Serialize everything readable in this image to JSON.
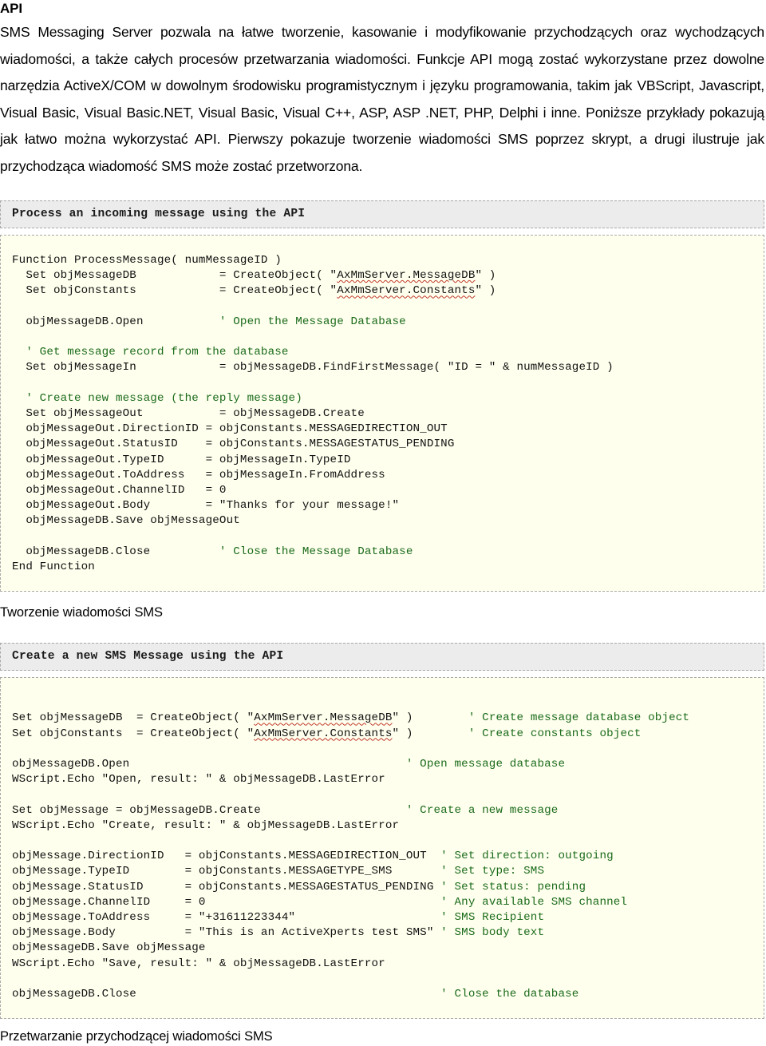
{
  "document": {
    "title": "API",
    "intro_paragraph": "SMS Messaging Server pozwala na łatwe tworzenie, kasowanie i modyfikowanie przychodzących oraz wychodzących wiadomości, a także całych procesów przetwarzania wiadomości. Funkcje API mogą zostać wykorzystane przez dowolne narzędzia ActiveX/COM w dowolnym środowisku programistycznym i języku programowania, takim jak VBScript, Javascript, Visual Basic, Visual Basic.NET, Visual Basic, Visual C++, ASP, ASP .NET, PHP, Delphi i inne. Poniższe przykłady pokazują jak łatwo można wykorzystać API. Pierwszy pokazuje tworzenie wiadomości SMS poprzez skrypt, a drugi ilustruje jak przychodząca wiadomość SMS może zostać przetworzona."
  },
  "sample_one": {
    "header": "Process an incoming message using the API",
    "caption": "Tworzenie wiadomości SMS",
    "lines": [
      {
        "text": "Function ProcessMessage( numMessageID )"
      },
      {
        "pre": "  Set objMessageDB            = CreateObject( \"",
        "warn": "AxMmServer.MessageDB",
        "post": "\" )"
      },
      {
        "pre": "  Set objConstants            = CreateObject( \"",
        "warn": "AxMmServer.Constants",
        "post": "\" )"
      },
      {
        "text": ""
      },
      {
        "pre": "  objMessageDB.Open           ",
        "comment": "' Open the Message Database"
      },
      {
        "text": ""
      },
      {
        "pre": "  ",
        "comment": "' Get message record from the database"
      },
      {
        "text": "  Set objMessageIn            = objMessageDB.FindFirstMessage( \"ID = \" & numMessageID )"
      },
      {
        "text": ""
      },
      {
        "pre": "  ",
        "comment": "' Create new message (the reply message)"
      },
      {
        "text": "  Set objMessageOut           = objMessageDB.Create"
      },
      {
        "text": "  objMessageOut.DirectionID = objConstants.MESSAGEDIRECTION_OUT"
      },
      {
        "text": "  objMessageOut.StatusID    = objConstants.MESSAGESTATUS_PENDING"
      },
      {
        "text": "  objMessageOut.TypeID      = objMessageIn.TypeID"
      },
      {
        "text": "  objMessageOut.ToAddress   = objMessageIn.FromAddress"
      },
      {
        "text": "  objMessageOut.ChannelID   = 0"
      },
      {
        "text": "  objMessageOut.Body        = \"Thanks for your message!\""
      },
      {
        "text": "  objMessageDB.Save objMessageOut"
      },
      {
        "text": ""
      },
      {
        "pre": "  objMessageDB.Close          ",
        "comment": "' Close the Message Database"
      },
      {
        "text": "End Function"
      }
    ]
  },
  "sample_two": {
    "header": "Create a new SMS Message using the API",
    "caption": "Przetwarzanie przychodzącej wiadomości SMS",
    "lines": [
      {
        "text": ""
      },
      {
        "pre": "Set objMessageDB  = CreateObject( \"",
        "warn": "AxMmServer.MessageDB",
        "post": "\" )        ",
        "comment": "' Create message database object"
      },
      {
        "pre": "Set objConstants  = CreateObject( \"",
        "warn": "AxMmServer.Constants",
        "post": "\" )        ",
        "comment": "' Create constants object"
      },
      {
        "text": ""
      },
      {
        "pre": "objMessageDB.Open                                        ",
        "comment": "' Open message database"
      },
      {
        "text": "WScript.Echo \"Open, result: \" & objMessageDB.LastError"
      },
      {
        "text": ""
      },
      {
        "pre": "Set objMessage = objMessageDB.Create                     ",
        "comment": "' Create a new message"
      },
      {
        "text": "WScript.Echo \"Create, result: \" & objMessageDB.LastError"
      },
      {
        "text": ""
      },
      {
        "pre": "objMessage.DirectionID   = objConstants.MESSAGEDIRECTION_OUT  ",
        "comment": "' Set direction: outgoing"
      },
      {
        "pre": "objMessage.TypeID        = objConstants.MESSAGETYPE_SMS       ",
        "comment": "' Set type: SMS"
      },
      {
        "pre": "objMessage.StatusID      = objConstants.MESSAGESTATUS_PENDING ",
        "comment": "' Set status: pending"
      },
      {
        "pre": "objMessage.ChannelID     = 0                                  ",
        "comment": "' Any available SMS channel"
      },
      {
        "pre": "objMessage.ToAddress     = \"+31611223344\"                     ",
        "comment": "' SMS Recipient"
      },
      {
        "pre": "objMessage.Body          = \"This is an ActiveXperts test SMS\" ",
        "comment": "' SMS body text"
      },
      {
        "text": "objMessageDB.Save objMessage"
      },
      {
        "text": "WScript.Echo \"Save, result: \" & objMessageDB.LastError"
      },
      {
        "text": ""
      },
      {
        "pre": "objMessageDB.Close                                            ",
        "comment": "' Close the database"
      }
    ]
  },
  "colors": {
    "code_background": "#ffffee",
    "header_background": "#ececec",
    "border": "#a9a9a9",
    "comment_text": "#1a6b1a",
    "spellcheck_underline": "#c0392b",
    "body_text": "#000000"
  }
}
